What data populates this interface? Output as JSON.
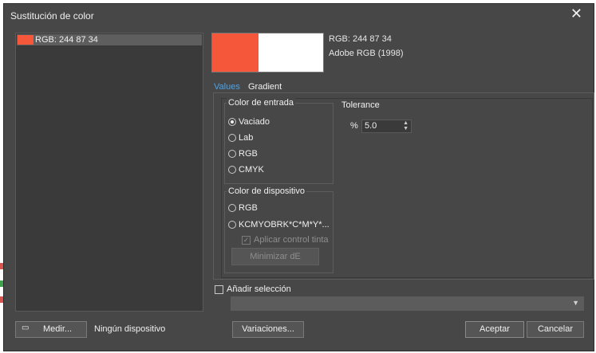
{
  "window": {
    "title": "Sustitución de color",
    "close_glyph": "✕"
  },
  "colors": {
    "swatch": "#f4573a"
  },
  "list": {
    "items": [
      {
        "label": "RGB: 244 87 34"
      }
    ]
  },
  "preview": {
    "line1": "RGB: 244 87 34",
    "line2": "Adobe RGB (1998)"
  },
  "tabs": [
    {
      "label": "Values",
      "active": true
    },
    {
      "label": "Gradient",
      "active": false
    }
  ],
  "input_color": {
    "title": "Color de entrada",
    "options": [
      {
        "label": "Vaciado",
        "selected": true
      },
      {
        "label": "Lab",
        "selected": false
      },
      {
        "label": "RGB",
        "selected": false
      },
      {
        "label": "CMYK",
        "selected": false
      }
    ]
  },
  "device_color": {
    "title": "Color de dispositivo",
    "options": [
      {
        "label": "RGB",
        "selected": false
      },
      {
        "label": "KCMYOBRK*C*M*Y*...",
        "selected": false
      }
    ],
    "apply_ink_control": {
      "label": "Aplicar control tinta",
      "checked": true,
      "enabled": false
    },
    "minimize_button": "Minimizar dE"
  },
  "tolerance": {
    "title": "Tolerance",
    "unit": "%",
    "value": "5.0"
  },
  "add_selection": {
    "label": "Añadir selección",
    "checked": false
  },
  "footer": {
    "measure_button": "Medir...",
    "device_status": "Ningún dispositivo",
    "variations_button": "Variaciones...",
    "accept_button": "Aceptar",
    "cancel_button": "Cancelar"
  }
}
